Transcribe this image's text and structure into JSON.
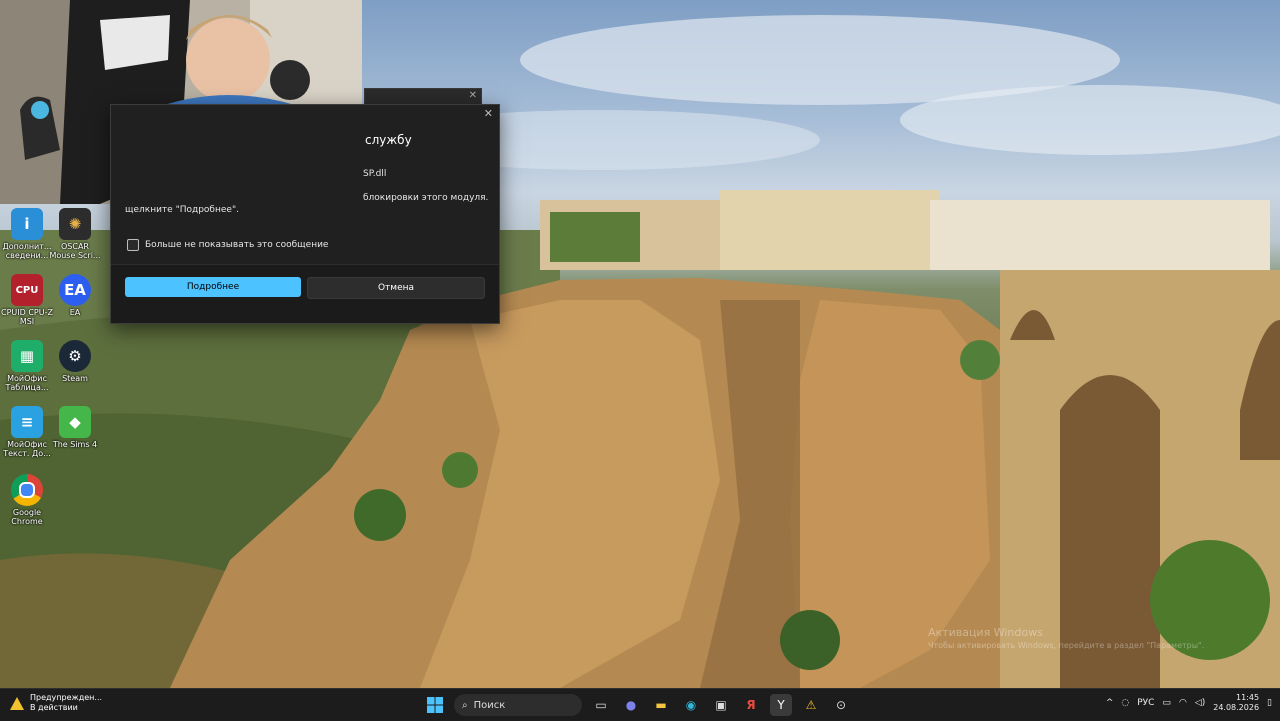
{
  "dialog": {
    "title": "службу",
    "line1": "SP.dll",
    "line2": "блокировки этого модуля.",
    "line3": "щелкните \"Подробнее\".",
    "checkbox_label": "Больше не показывать это сообщение",
    "primary_button": "Подробнее",
    "secondary_button": "Отмена"
  },
  "desktop_icons": [
    {
      "label": "Дополнит...\nсведени...",
      "icon": "info-icon"
    },
    {
      "label": "OSCAR\nMouse Scri...",
      "icon": "oscar-icon"
    },
    {
      "label": "CPUID CPU-Z\nMSI",
      "icon": "cpuz-icon"
    },
    {
      "label": "EA",
      "icon": "ea-icon"
    },
    {
      "label": "МойОфис\nТаблица...",
      "icon": "myoffice-table-icon"
    },
    {
      "label": "Steam",
      "icon": "steam-icon"
    },
    {
      "label": "МойОфис\nТекст. До...",
      "icon": "myoffice-text-icon"
    },
    {
      "label": "The Sims 4",
      "icon": "sims-icon"
    },
    {
      "label": "Google\nChrome",
      "icon": "chrome-icon"
    }
  ],
  "watermark": {
    "line1": "Активация Windows",
    "line2": "Чтобы активировать Windows, перейдите в раздел \"Параметры\"."
  },
  "taskbar": {
    "notification": "Предупрежден...\nВ действии",
    "search_placeholder": "Поиск",
    "language": "РУС",
    "time": "11:45",
    "date": "24.08.2026"
  },
  "colors": {
    "accent": "#4cc2ff",
    "dialog_bg": "#202020",
    "taskbar_bg": "#1c1c1c"
  }
}
